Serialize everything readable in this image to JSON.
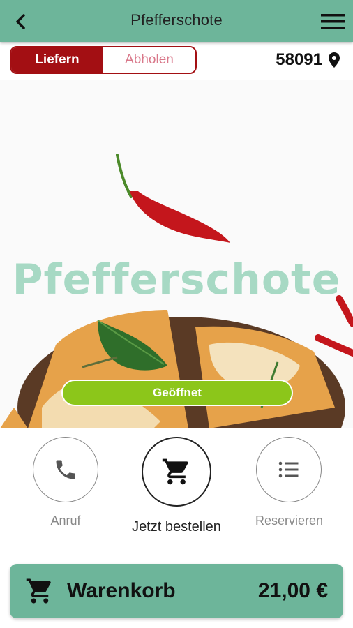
{
  "header": {
    "title": "Pfefferschote"
  },
  "delivery": {
    "deliver_label": "Liefern",
    "pickup_label": "Abholen",
    "postal_code": "58091"
  },
  "hero": {
    "brand_text": "Pfefferschote",
    "status": "Geöffnet"
  },
  "actions": [
    {
      "label": "Anruf"
    },
    {
      "label": "Jetzt bestellen"
    },
    {
      "label": "Reservieren"
    }
  ],
  "cart": {
    "label": "Warenkorb",
    "total": "21,00 €"
  },
  "colors": {
    "brand_green": "#6db59a",
    "accent_red": "#a30f13",
    "open_green": "#8cc61a",
    "logo_mint": "#a7d9c4"
  },
  "icons": [
    "back-arrow-icon",
    "hamburger-menu-icon",
    "location-pin-icon",
    "phone-icon",
    "cart-icon",
    "list-icon"
  ]
}
